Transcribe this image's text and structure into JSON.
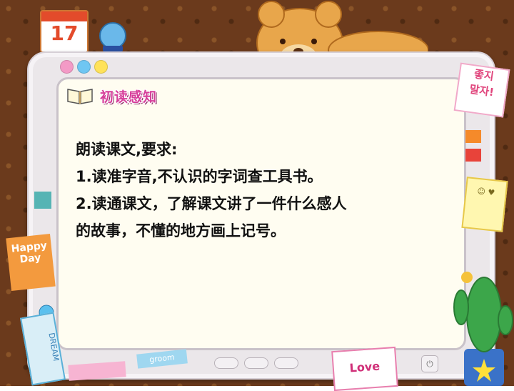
{
  "calendar": {
    "day": "17"
  },
  "slide": {
    "title": "初读感知",
    "body_lines": [
      "朗读课文,要求:",
      "1.读准字音,不认识的字词查工具书。",
      "2.读通课文，了解课文讲了一件什么感人",
      "的故事，不懂的地方画上记号。"
    ]
  },
  "stickers": {
    "korean_note": "좋지\n말자!",
    "happy_day": "Happy\nDay",
    "dream": "DREAM",
    "love": "Love",
    "groom": "groom"
  },
  "colors": {
    "title": "#d63f9a",
    "background": "#6b3a1c",
    "screen": "#fffdf1"
  }
}
